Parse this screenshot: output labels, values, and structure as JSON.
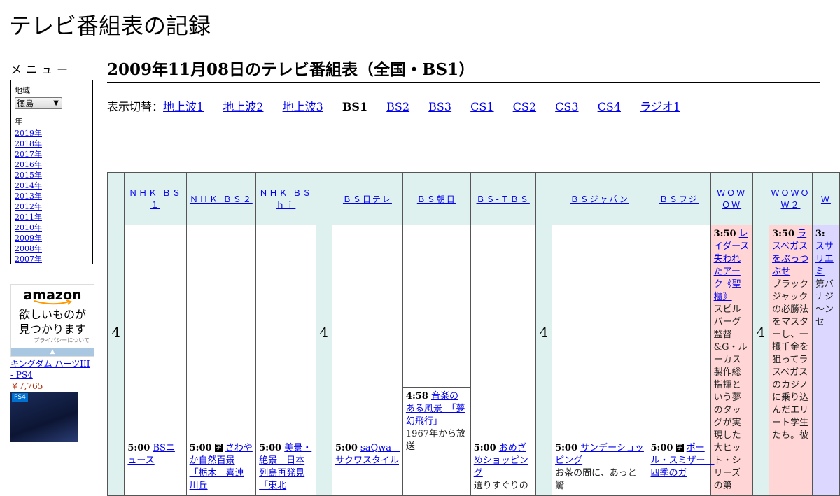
{
  "site": {
    "title": "テレビ番組表の記録"
  },
  "sidebar": {
    "menu_title": "メニュー",
    "region_label": "地域",
    "region_value": "徳島",
    "year_label": "年",
    "years": [
      "2019年",
      "2018年",
      "2017年",
      "2016年",
      "2015年",
      "2014年",
      "2013年",
      "2012年",
      "2011年",
      "2010年",
      "2009年",
      "2008年",
      "2007年"
    ]
  },
  "ad": {
    "logo": "amazon",
    "text_line1": "欲しいものが",
    "text_line2": "見つかります",
    "privacy": "プライバシーについて",
    "product_title": "キングダム ハーツIII - PS4",
    "product_price": "￥7,765",
    "product_badge": "PS4"
  },
  "main": {
    "heading": "2009年11月08日のテレビ番組表（全国・BS1）",
    "switch_label": "表示切替：",
    "switch_items": [
      "地上波1",
      "地上波2",
      "地上波3",
      "BS1",
      "BS2",
      "BS3",
      "CS1",
      "CS2",
      "CS3",
      "CS4",
      "ラジオ1"
    ],
    "current": "BS1"
  },
  "grid": {
    "hour_4": "4",
    "channels": [
      "ＮＨＫ ＢＳ１",
      "ＮＨＫ ＢＳ２",
      "ＮＨＫ ＢＳ ｈｉ",
      "ＢＳ日テレ",
      "ＢＳ朝日",
      "ＢＳ-ＴＢＳ",
      "ＢＳジャパン",
      "ＢＳフジ",
      "ＷＯＷＯＷ",
      "ＷＯＷＯＷ２",
      "Ｗ"
    ],
    "programs": {
      "wowow": {
        "time": "3:50",
        "title": "レイダース　失われたアーク《聖櫃》",
        "desc": "スピルバーグ監督&G・ルーカス製作総指揮という夢のタッグが実現した大ヒット・シリーズの第"
      },
      "wowow2": {
        "time": "3:50",
        "title": "ラスベガスをぶっつぶせ",
        "desc": "ブラックジャックの必勝法をマスターし、一攫千金を狙ってラスベガスのカジノに乗り込んだエリート学生たち。彼"
      },
      "w3": {
        "time": "3:",
        "title": "スサリエミ",
        "desc": "第バナジ～ンセ"
      },
      "bs_asahi_458": {
        "time": "4:58",
        "title": "音楽のある風景　「夢幻飛行」",
        "desc": "1967年から放送"
      },
      "nhk_bs1_500": {
        "time": "5:00",
        "title": "BSニュース"
      },
      "nhk_bs2_500": {
        "time": "5:00",
        "title": "さわやか自然百景「栃木　喜連川丘"
      },
      "nhk_hi_500": {
        "time": "5:00",
        "title": "美景・絶景　日本列島再発見「東北"
      },
      "bs_ntv_500": {
        "time": "5:00",
        "title": "saQwa　サクワスタイル"
      },
      "bs_tbs_500": {
        "time": "5:00",
        "title": "おめざめショッピング",
        "desc": "選りすぐりの"
      },
      "bs_japan_500": {
        "time": "5:00",
        "title": "サンデーショッピング",
        "desc": "お茶の間に、あっと驚"
      },
      "bs_fuji_500": {
        "time": "5:00",
        "title": "ポール・スミザー　四季のガ"
      }
    },
    "icon_text": "字"
  }
}
